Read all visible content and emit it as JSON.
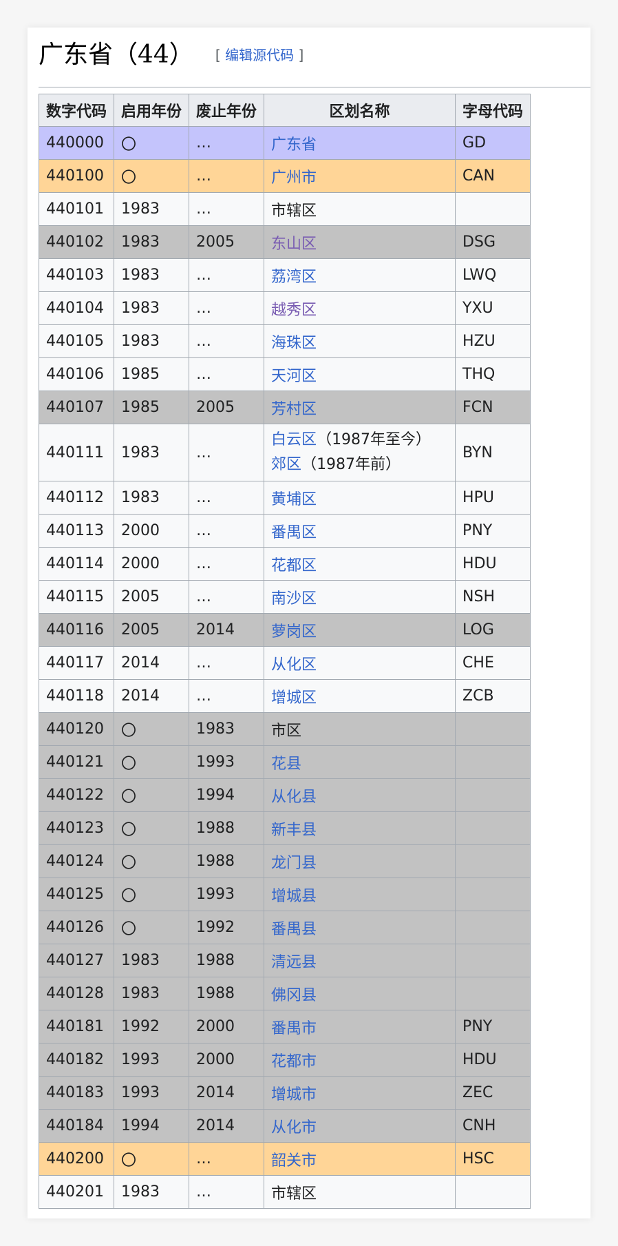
{
  "section": {
    "title": "广东省（44）",
    "edit_open": "[",
    "edit_label": "编辑源代码",
    "edit_close": "]"
  },
  "table": {
    "headers": [
      "数字代码",
      "启用年份",
      "废止年份",
      "区划名称",
      "字母代码"
    ],
    "colors": {
      "province": "#c4c4fc",
      "city": "#ffd597",
      "abolished": "#c2c2c2",
      "link": "#3366cc",
      "visited_link": "#795cb2"
    },
    "rows": [
      {
        "type": "province",
        "code": "440000",
        "start": "〇",
        "end": "…",
        "name": "广东省",
        "link": true,
        "alpha": "GD"
      },
      {
        "type": "city",
        "code": "440100",
        "start": "〇",
        "end": "…",
        "name": "广州市",
        "link": true,
        "alpha": "CAN"
      },
      {
        "type": "normal",
        "code": "440101",
        "start": "1983",
        "end": "…",
        "name": "市辖区",
        "link": false,
        "alpha": ""
      },
      {
        "type": "abolished",
        "code": "440102",
        "start": "1983",
        "end": "2005",
        "name": "东山区",
        "link": true,
        "visited": true,
        "alpha": "DSG"
      },
      {
        "type": "normal",
        "code": "440103",
        "start": "1983",
        "end": "…",
        "name": "荔湾区",
        "link": true,
        "alpha": "LWQ"
      },
      {
        "type": "normal",
        "code": "440104",
        "start": "1983",
        "end": "…",
        "name": "越秀区",
        "link": true,
        "visited": true,
        "alpha": "YXU"
      },
      {
        "type": "normal",
        "code": "440105",
        "start": "1983",
        "end": "…",
        "name": "海珠区",
        "link": true,
        "alpha": "HZU"
      },
      {
        "type": "normal",
        "code": "440106",
        "start": "1985",
        "end": "…",
        "name": "天河区",
        "link": true,
        "alpha": "THQ"
      },
      {
        "type": "abolished",
        "code": "440107",
        "start": "1985",
        "end": "2005",
        "name": "芳村区",
        "link": true,
        "alpha": "FCN"
      },
      {
        "type": "normal",
        "tall": true,
        "code": "440111",
        "start": "1983",
        "end": "…",
        "name_lines": [
          {
            "name": "白云区",
            "note": "（1987年至今）"
          },
          {
            "name": "郊区",
            "note": "（1987年前）"
          }
        ],
        "alpha": "BYN"
      },
      {
        "type": "normal",
        "code": "440112",
        "start": "1983",
        "end": "…",
        "name": "黄埔区",
        "link": true,
        "alpha": "HPU"
      },
      {
        "type": "normal",
        "code": "440113",
        "start": "2000",
        "end": "…",
        "name": "番禺区",
        "link": true,
        "alpha": "PNY"
      },
      {
        "type": "normal",
        "code": "440114",
        "start": "2000",
        "end": "…",
        "name": "花都区",
        "link": true,
        "alpha": "HDU"
      },
      {
        "type": "normal",
        "code": "440115",
        "start": "2005",
        "end": "…",
        "name": "南沙区",
        "link": true,
        "alpha": "NSH"
      },
      {
        "type": "abolished",
        "code": "440116",
        "start": "2005",
        "end": "2014",
        "name": "萝岗区",
        "link": true,
        "alpha": "LOG"
      },
      {
        "type": "normal",
        "code": "440117",
        "start": "2014",
        "end": "…",
        "name": "从化区",
        "link": true,
        "alpha": "CHE"
      },
      {
        "type": "normal",
        "code": "440118",
        "start": "2014",
        "end": "…",
        "name": "增城区",
        "link": true,
        "alpha": "ZCB"
      },
      {
        "type": "abolished",
        "code": "440120",
        "start": "〇",
        "end": "1983",
        "name": "市区",
        "link": false,
        "alpha": ""
      },
      {
        "type": "abolished",
        "code": "440121",
        "start": "〇",
        "end": "1993",
        "name": "花县",
        "link": true,
        "alpha": ""
      },
      {
        "type": "abolished",
        "code": "440122",
        "start": "〇",
        "end": "1994",
        "name": "从化县",
        "link": true,
        "alpha": ""
      },
      {
        "type": "abolished",
        "code": "440123",
        "start": "〇",
        "end": "1988",
        "name": "新丰县",
        "link": true,
        "alpha": ""
      },
      {
        "type": "abolished",
        "code": "440124",
        "start": "〇",
        "end": "1988",
        "name": "龙门县",
        "link": true,
        "alpha": ""
      },
      {
        "type": "abolished",
        "code": "440125",
        "start": "〇",
        "end": "1993",
        "name": "增城县",
        "link": true,
        "alpha": ""
      },
      {
        "type": "abolished",
        "code": "440126",
        "start": "〇",
        "end": "1992",
        "name": "番禺县",
        "link": true,
        "alpha": ""
      },
      {
        "type": "abolished",
        "code": "440127",
        "start": "1983",
        "end": "1988",
        "name": "清远县",
        "link": true,
        "alpha": ""
      },
      {
        "type": "abolished",
        "code": "440128",
        "start": "1983",
        "end": "1988",
        "name": "佛冈县",
        "link": true,
        "alpha": ""
      },
      {
        "type": "abolished",
        "code": "440181",
        "start": "1992",
        "end": "2000",
        "name": "番禺市",
        "link": true,
        "alpha": "PNY"
      },
      {
        "type": "abolished",
        "code": "440182",
        "start": "1993",
        "end": "2000",
        "name": "花都市",
        "link": true,
        "alpha": "HDU"
      },
      {
        "type": "abolished",
        "code": "440183",
        "start": "1993",
        "end": "2014",
        "name": "增城市",
        "link": true,
        "alpha": "ZEC"
      },
      {
        "type": "abolished",
        "code": "440184",
        "start": "1994",
        "end": "2014",
        "name": "从化市",
        "link": true,
        "alpha": "CNH"
      },
      {
        "type": "city",
        "code": "440200",
        "start": "〇",
        "end": "…",
        "name": "韶关市",
        "link": true,
        "alpha": "HSC"
      },
      {
        "type": "normal",
        "code": "440201",
        "start": "1983",
        "end": "…",
        "name": "市辖区",
        "link": false,
        "alpha": ""
      }
    ]
  }
}
